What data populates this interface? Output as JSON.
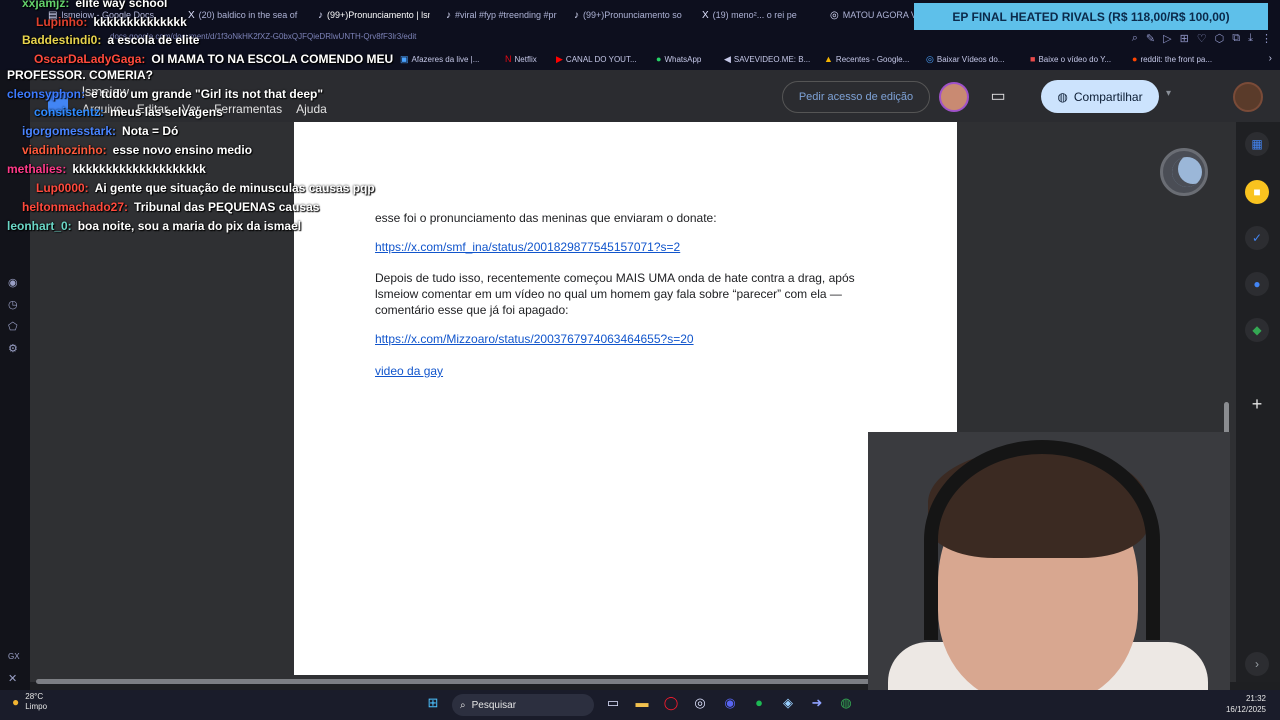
{
  "browser": {
    "tabs": [
      {
        "icon": "▤",
        "label": "lsmeiow - Google Docs"
      },
      {
        "icon": "X",
        "label": "(20) baldico in the sea of"
      },
      {
        "icon": "♪",
        "label": "(99+)Pronunciamento | lsmeiow"
      },
      {
        "icon": "♪",
        "label": "#viral #fyp #treending #pr"
      },
      {
        "icon": "♪",
        "label": "(99+)Pronunciamento so"
      },
      {
        "icon": "X",
        "label": "(19) meno²... o rei pe"
      },
      {
        "icon": "◎",
        "label": "MATOU AGORA VO"
      }
    ],
    "banner": "EP FINAL HEATED RIVALS (R$ 118,00/R$ 100,00)",
    "url": "docs.google.com/document/d/1f3oNkHK2fXZ-G0bxQJFQieDRlwUNTH-Qrv8fF3lr3/edit",
    "bookmarks": [
      {
        "icon": "▣",
        "label": "Afazeres da live |..."
      },
      {
        "icon": "N",
        "label": "Netflix"
      },
      {
        "icon": "▶",
        "label": "CANAL DO YOUT..."
      },
      {
        "icon": "●",
        "label": "WhatsApp"
      },
      {
        "icon": "◀",
        "label": "SAVEVIDEO.ME: B..."
      },
      {
        "icon": "▲",
        "label": "Recentes - Google..."
      },
      {
        "icon": "◎",
        "label": "Baixar Vídeos do..."
      },
      {
        "icon": "■",
        "label": "Baixe o vídeo do Y..."
      },
      {
        "icon": "●",
        "label": "reddit: the front pa..."
      }
    ]
  },
  "docs": {
    "title": "lsmeiow",
    "menu": [
      "Arquivo",
      "Editar",
      "Ver",
      "Ferramentas",
      "Ajuda"
    ],
    "access_button": "Pedir acesso de edição",
    "share_button": "Compartilhar"
  },
  "document": {
    "p1": "esse foi o pronunciamento das meninas que enviaram o donate:",
    "link1": "https://x.com/smf_ina/status/2001829877545157071?s=2",
    "p2a": "Depois de tudo isso, recentemente começou MAIS UMA onda de hate contra a drag, após",
    "p2b": "lsmeiow comentar em um vídeo no qual um homem gay fala sobre “parecer” com ela —",
    "p2c": "comentário esse que já foi apagado:",
    "link2": "https://x.com/Mizzoaro/status/2003767974063464655?s=20",
    "link3": "video da gay"
  },
  "chat": [
    {
      "user": "xxjamjz:",
      "text": "elite way school",
      "color": "#63d16b"
    },
    {
      "user": "Lupinho:",
      "text": "kkkkkkkkkkkkkk",
      "color": "#e0402e"
    },
    {
      "user": "Baddestindi0:",
      "text": "a escola de elite",
      "color": "#e8d44d"
    },
    {
      "user": "OscarDaLadyGaga:",
      "text": "OI MAMA TO NA ESCOLA COMENDO MEU",
      "color": "#ff4a3d"
    },
    {
      "user": "",
      "text": "PROFESSOR. COMERIA?",
      "color": "#ffffff"
    },
    {
      "user": "cleonsyphon:",
      "text": "e tudo um grande \"Girl its not that deep\"",
      "color": "#3d7bff"
    },
    {
      "user": "consistentz:",
      "text": "meus las selvagens",
      "color": "#2f8bff"
    },
    {
      "user": "igorgomesstark:",
      "text": "Nota = Dó",
      "color": "#4a84ff"
    },
    {
      "user": "viadinhozinho:",
      "text": "esse novo ensino medio",
      "color": "#ff5a3c"
    },
    {
      "user": "methalies:",
      "text": "kkkkkkkkkkkkkkkkkkkk",
      "color": "#ff3a8a"
    },
    {
      "user": "Lup0000:",
      "text": "Ai gente que situação de minusculas causas pqp",
      "color": "#ff4a3d"
    },
    {
      "user": "heltonmachado27:",
      "text": "Tribunal das PEQUENAS causas",
      "color": "#ff4a3d"
    },
    {
      "user": "leonhart_0:",
      "text": "boa noite, sou a maria do pix da ismael",
      "color": "#6ad6c6"
    }
  ],
  "taskbar": {
    "temperature": "28°C",
    "weather": "Limpo",
    "search": "Pesquisar",
    "time": "21:32",
    "date": "16/12/2025"
  },
  "colors": {
    "accent": "#cce3fd",
    "link": "#1155cc",
    "banner": "#5ec0ea"
  }
}
